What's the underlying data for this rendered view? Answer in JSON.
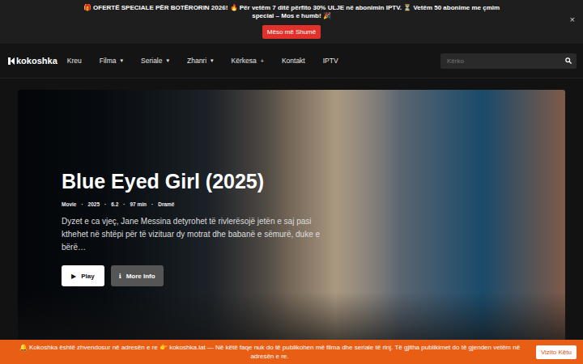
{
  "promo": {
    "text": "🎁 OFERTË SPECIALE PËR BOTËRORIN 2026! 🔥 Për vetëm 7 ditë përfito 30% ULJE në abonimin IPTV. ⏳ Vetëm 50 abonime me çmim special – Mos e humb! 🎉",
    "button": "Mëso më Shumë",
    "close": "×"
  },
  "nav": {
    "logo": "kokoshka",
    "items": [
      {
        "label": "Kreu",
        "marker": ""
      },
      {
        "label": "Filma",
        "marker": "▾"
      },
      {
        "label": "Seriale",
        "marker": "▾"
      },
      {
        "label": "Zhanri",
        "marker": "▾"
      },
      {
        "label": "Kërkesa",
        "marker": "+"
      },
      {
        "label": "Kontakt",
        "marker": ""
      },
      {
        "label": "IPTV",
        "marker": ""
      }
    ]
  },
  "search": {
    "placeholder": "Kërko"
  },
  "hero": {
    "title": "Blue Eyed Girl (2025)",
    "meta": [
      "Movie",
      "·",
      "2025",
      "·",
      "6.2",
      "·",
      "97 min",
      "·",
      "Dramë"
    ],
    "description": "Dyzet e ca vjeç, Jane Messina detyrohet të rivlerësojë jetën e saj pasi kthehet në shtëpi për të vizituar dy motrat dhe babanë e sëmurë, duke e bërë…",
    "buttons": [
      {
        "icon": "▶",
        "label": "Play",
        "kind": "primary"
      },
      {
        "icon": "ℹ",
        "label": "More Info",
        "kind": "secondary"
      }
    ]
  },
  "notice": {
    "text": "🔔 Kokoshka është zhvendosur në adresën e re 👉 kokoshka.lat — Në këtë faqe nuk do të publikohen më filma dhe seriale të rinj. Të gjitha publikimet do të gjenden vetëm në adresën e re.",
    "button": "Vizito Këtu"
  }
}
